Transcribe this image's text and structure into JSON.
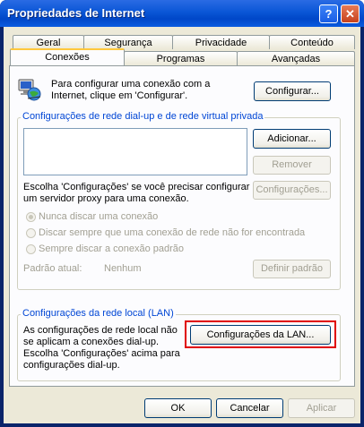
{
  "window": {
    "title": "Propriedades de Internet",
    "help_label": "?",
    "close_label": "✕"
  },
  "tabs": {
    "row1": [
      "Geral",
      "Segurança",
      "Privacidade",
      "Conteúdo"
    ],
    "row2": [
      "Conexões",
      "Programas",
      "Avançadas"
    ],
    "selected": "Conexões"
  },
  "setup": {
    "text_line1": "Para configurar uma conexão com a",
    "text_line2": "Internet, clique em 'Configurar'.",
    "configure_label": "Configurar...",
    "icon": "network-globe-icon"
  },
  "dialup": {
    "title": "Configurações de rede dial-up e de rede virtual privada",
    "add_label": "Adicionar...",
    "remove_label": "Remover",
    "settings_text_line1": "Escolha 'Configurações' se você precisar configurar",
    "settings_text_line2": "um servidor proxy para uma conexão.",
    "settings_label": "Configurações...",
    "radio_never": "Nunca discar uma conexão",
    "radio_when_no_network": "Discar sempre que uma conexão de rede não for encontrada",
    "radio_always": "Sempre discar a conexão padrão",
    "radio_selected": "never",
    "current_default_label": "Padrão atual:",
    "current_default_value": "Nenhum",
    "set_default_label": "Definir padrão"
  },
  "lan": {
    "title": "Configurações da rede local (LAN)",
    "text_line1": "As configurações de rede local não",
    "text_line2": "se aplicam a conexões dial-up.",
    "text_line3": "Escolha 'Configurações' acima para",
    "text_line4": "configurações dial-up.",
    "lan_settings_label": "Configurações da LAN...",
    "highlight_color": "#e00000"
  },
  "footer": {
    "ok_label": "OK",
    "cancel_label": "Cancelar",
    "apply_label": "Aplicar"
  },
  "colors": {
    "titlebar": "#0a56d6",
    "group_title": "#0046d5",
    "face": "#ece9d8"
  }
}
